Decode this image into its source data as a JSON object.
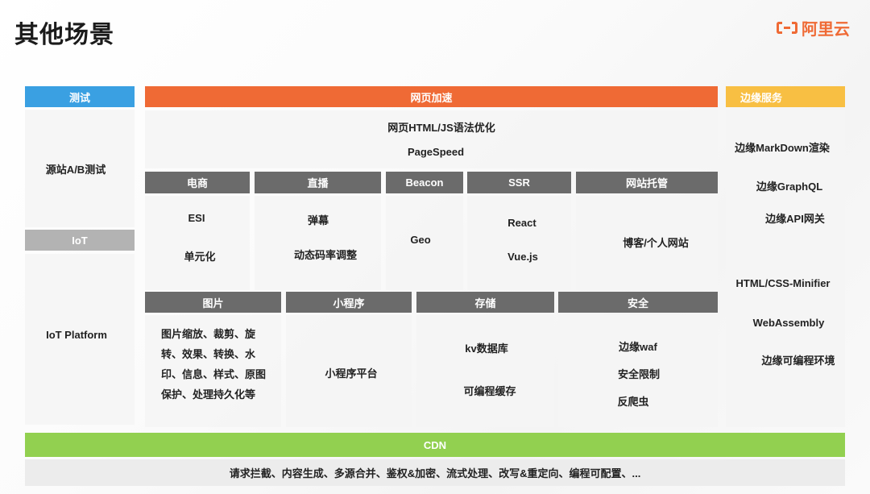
{
  "title": "其他场景",
  "logo": {
    "icon": "aliyun-logo-icon",
    "text": "阿里云",
    "color": "#ef6a35"
  },
  "colors": {
    "test": "#3aa0e2",
    "web_accel": "#ef6a35",
    "edge_service": "#f8bf43",
    "iot": "#b3b3b3",
    "category": "#6b6b6b",
    "cdn": "#92d050"
  },
  "test": {
    "header": "测试",
    "item": "源站A/B测试"
  },
  "iot": {
    "header": "IoT",
    "item": "IoT Platform"
  },
  "web_accel": {
    "header": "网页加速",
    "items": [
      "网页HTML/JS语法优化",
      "PageSpeed"
    ],
    "row1": [
      {
        "header": "电商",
        "items": [
          "ESI",
          "单元化"
        ]
      },
      {
        "header": "直播",
        "items": [
          "弹幕",
          "动态码率调整"
        ]
      },
      {
        "header": "Beacon",
        "items": [
          "Geo"
        ]
      },
      {
        "header": "SSR",
        "items": [
          "React",
          "Vue.js"
        ]
      },
      {
        "header": "网站托管",
        "items": [
          "博客/个人网站"
        ]
      }
    ],
    "row2": [
      {
        "header": "图片",
        "text": "图片缩放、裁剪、旋转、效果、转换、水印、信息、样式、原图保护、处理持久化等"
      },
      {
        "header": "小程序",
        "items": [
          "小程序平台"
        ]
      },
      {
        "header": "存储",
        "items": [
          "kv数据库",
          "可编程缓存"
        ]
      },
      {
        "header": "安全",
        "items": [
          "边缘waf",
          "安全限制",
          "反爬虫"
        ]
      }
    ]
  },
  "edge_service": {
    "header": "边缘服务",
    "items": [
      "边缘MarkDown渲染",
      "边缘GraphQL",
      "边缘API网关",
      "HTML/CSS-Minifier",
      "WebAssembly",
      "边缘可编程环境"
    ]
  },
  "cdn": {
    "header": "CDN",
    "text": "请求拦截、内容生成、多源合并、鉴权&加密、流式处理、改写&重定向、编程可配置、..."
  }
}
